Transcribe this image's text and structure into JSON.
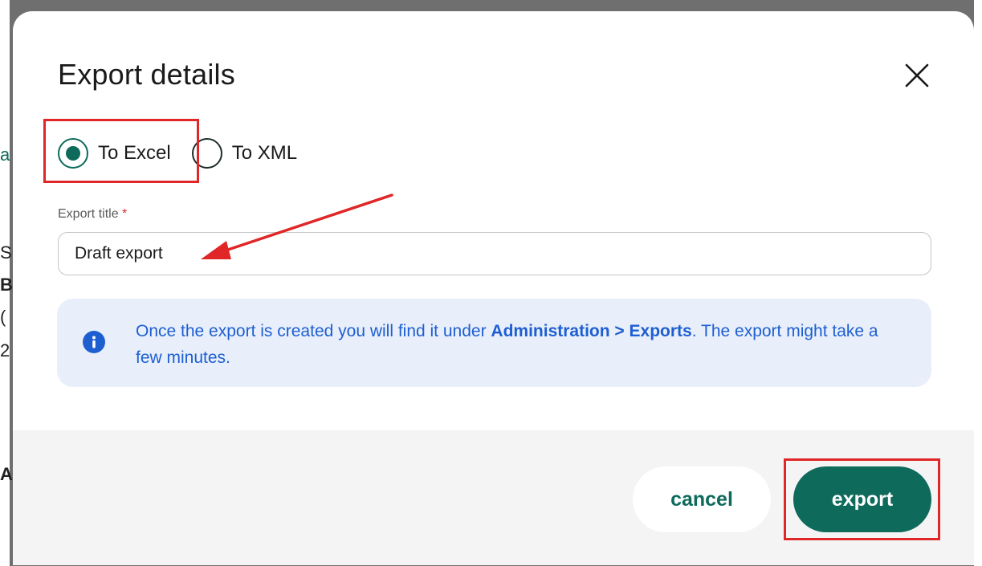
{
  "dialog": {
    "title": "Export details",
    "format_options": [
      {
        "label": "To Excel",
        "selected": true
      },
      {
        "label": "To XML",
        "selected": false
      }
    ],
    "export_title_label": "Export title",
    "required_marker": "*",
    "export_title_value": "Draft export",
    "info": {
      "text_before": "Once the export is created you will find it under ",
      "text_bold": "Administration > Exports",
      "text_after": ". The export might take a few minutes."
    },
    "buttons": {
      "cancel_label": "cancel",
      "export_label": "export"
    }
  },
  "background_page": {
    "left_edge_glyphs": [
      "a",
      "S",
      "B",
      "(",
      "2",
      "A"
    ]
  },
  "colors": {
    "accent_green": "#0e6b5c",
    "info_blue": "#1d5fd1",
    "info_bg": "#e9effa",
    "annotation_red": "#e02626",
    "overlay": "#6f6f6f"
  }
}
